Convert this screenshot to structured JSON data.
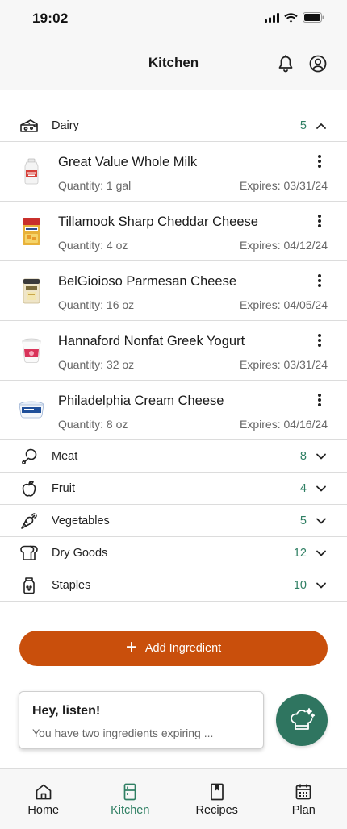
{
  "status_bar": {
    "time": "19:02"
  },
  "header": {
    "title": "Kitchen"
  },
  "categories": {
    "dairy": {
      "label": "Dairy",
      "count": "5",
      "expanded": true
    },
    "meat": {
      "label": "Meat",
      "count": "8"
    },
    "fruit": {
      "label": "Fruit",
      "count": "4"
    },
    "vegetables": {
      "label": "Vegetables",
      "count": "5"
    },
    "dry_goods": {
      "label": "Dry Goods",
      "count": "12"
    },
    "staples": {
      "label": "Staples",
      "count": "10"
    }
  },
  "dairy_items": [
    {
      "name": "Great Value Whole Milk",
      "quantity": "Quantity: 1 gal",
      "expires": "Expires: 03/31/24"
    },
    {
      "name": "Tillamook Sharp Cheddar Cheese",
      "quantity": "Quantity: 4 oz",
      "expires": "Expires: 04/12/24"
    },
    {
      "name": "BelGioioso Parmesan Cheese",
      "quantity": "Quantity: 16 oz",
      "expires": "Expires: 04/05/24"
    },
    {
      "name": "Hannaford Nonfat Greek Yogurt",
      "quantity": "Quantity: 32 oz",
      "expires": "Expires: 03/31/24"
    },
    {
      "name": "Philadelphia Cream Cheese",
      "quantity": "Quantity: 8 oz",
      "expires": "Expires: 04/16/24"
    }
  ],
  "actions": {
    "add_ingredient": "Add Ingredient"
  },
  "notice": {
    "title": "Hey, listen!",
    "body": "You have two ingredients expiring ..."
  },
  "nav": {
    "home": "Home",
    "kitchen": "Kitchen",
    "recipes": "Recipes",
    "plan": "Plan",
    "active": "kitchen"
  },
  "colors": {
    "accent_green": "#2f7f63",
    "fab_green": "#2f7560",
    "add_button_orange": "#c94f0c"
  },
  "icons": {
    "header": [
      "bell-icon",
      "profile-icon"
    ],
    "categories": [
      "cheese-icon",
      "drumstick-icon",
      "apple-icon",
      "carrot-icon",
      "bread-icon",
      "salt-shaker-icon"
    ],
    "fab": "chef-hat-icon"
  }
}
